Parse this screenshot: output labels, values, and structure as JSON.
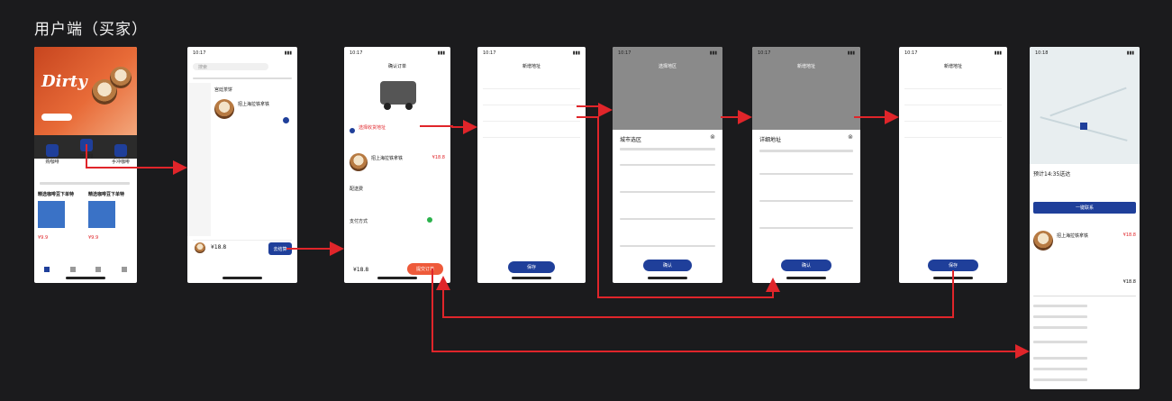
{
  "title": "用户端（买家）",
  "colors": {
    "arrow": "#e0252a",
    "brand_blue": "#1f3f9a",
    "accent_orange": "#ee5a3a",
    "background": "#1b1b1d"
  },
  "screen1": {
    "banner_text": "Dirty",
    "category_1": "购咖啡",
    "category_2": "售咖啡",
    "category_3": "手冲咖啡",
    "product_1": "精选咖啡豆下单特",
    "product_2": "精选咖啡豆下单特",
    "price_1": "¥9.9",
    "price_2": "¥9.9"
  },
  "screen2": {
    "time": "10:17",
    "search_placeholder": "搜索",
    "shop_name": "宫廷茶饼",
    "item_name": "招上海拉铁拿铁",
    "cart_total": "¥18.8",
    "checkout": "去结算"
  },
  "screen3": {
    "time": "10:17",
    "header": "确认订单",
    "select_address": "选择收货地址",
    "item_name": "招上海拉铁拿铁",
    "price": "¥18.8",
    "delivery_fee": "配送费",
    "pay_method": "支付方式",
    "total": "¥18.8",
    "submit": "提交订单"
  },
  "screen4": {
    "time": "10:17",
    "header": "新增地址",
    "confirm": "保存"
  },
  "screen5": {
    "time": "10:17",
    "header": "选择地区",
    "sheet_title": "城市选区",
    "confirm": "确认"
  },
  "screen6": {
    "time": "10:17",
    "header": "新增地址",
    "sheet_title": "详细地址",
    "confirm": "确认"
  },
  "screen7": {
    "time": "10:17",
    "header": "新增地址",
    "confirm": "保存"
  },
  "screen8": {
    "time": "10:18",
    "status": "预计14:35送达",
    "contact_button": "一键联系",
    "item_name": "招上海拉铁拿铁",
    "price": "¥18.8",
    "total": "¥18.8"
  }
}
